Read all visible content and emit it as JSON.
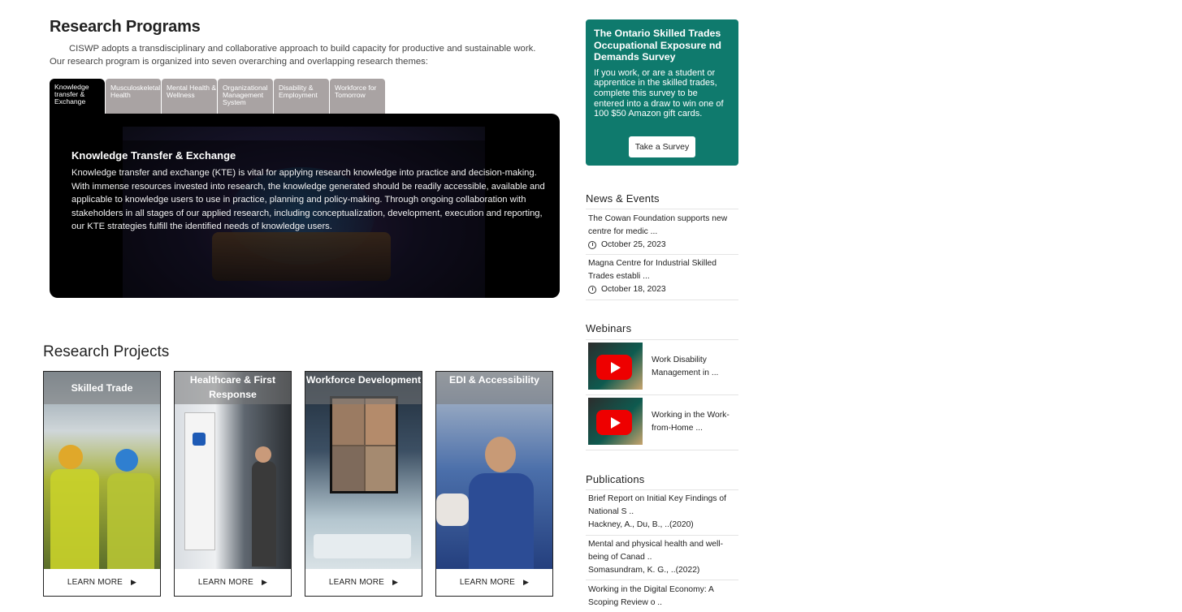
{
  "programs": {
    "title": "Research Programs",
    "intro": "CISWP adopts a transdisciplinary and collaborative approach to build capacity for productive and sustainable work. Our research program is organized into seven overarching and overlapping research themes:",
    "tabs": [
      {
        "label": "Knowledge transfer & Exchange"
      },
      {
        "label": "Musculoskeletal Health"
      },
      {
        "label": "Mental Health & Wellness"
      },
      {
        "label": "Organizational Management System"
      },
      {
        "label": "Disability & Employment"
      },
      {
        "label": "Workforce for Tomorrow"
      }
    ],
    "panel": {
      "heading": "Knowledge Transfer & Exchange",
      "body": "Knowledge transfer and exchange (KTE) is vital for applying research knowledge into practice and decision-making. With immense resources invested into research, the knowledge generated should be readily accessible, available and applicable to knowledge users to use in practice, planning and policy-making. Through ongoing collaboration with stakeholders in all stages of our applied research, including conceptualization, development, execution and reporting, our KTE strategies fulfill the identified needs of knowledge users."
    }
  },
  "projects": {
    "title": "Research Projects",
    "cards": [
      {
        "title": "Skilled Trade",
        "cta": "LEARN MORE"
      },
      {
        "title": "Healthcare & First Response",
        "cta": "LEARN MORE"
      },
      {
        "title": "Workforce Development",
        "cta": "LEARN MORE"
      },
      {
        "title": "EDI & Accessibility",
        "cta": "LEARN MORE"
      }
    ],
    "caret_icon": "caret-right-icon"
  },
  "survey": {
    "title": "The Ontario Skilled Trades Occupational Exposure nd Demands Survey",
    "text": "If you work, or are a student or apprentice in the skilled trades, complete this survey to be entered into a draw to win one of 100 $50 Amazon gift cards.",
    "button": "Take a Survey",
    "bg_color": "#0f7a6d"
  },
  "news": {
    "heading": "News & Events",
    "items": [
      {
        "title": "The Cowan Foundation supports new centre for medic ...",
        "date": "October 25, 2023"
      },
      {
        "title": "Magna Centre for Industrial Skilled Trades establi ...",
        "date": "October 18, 2023"
      }
    ]
  },
  "webinars": {
    "heading": "Webinars",
    "items": [
      {
        "title": "Work Disability Management in ..."
      },
      {
        "title": "Working in the Work-from-Home ..."
      }
    ]
  },
  "publications": {
    "heading": "Publications",
    "items": [
      {
        "title": "Brief Report on Initial Key Findings of National S ..",
        "authors": "Hackney, A., Du, B., ..(2020)"
      },
      {
        "title": "Mental and physical health and well-being of Canad ..",
        "authors": "Somasundram, K. G., ..(2022)"
      },
      {
        "title": "Working in the Digital Economy: A Scoping Review o ..",
        "authors": ""
      }
    ]
  }
}
